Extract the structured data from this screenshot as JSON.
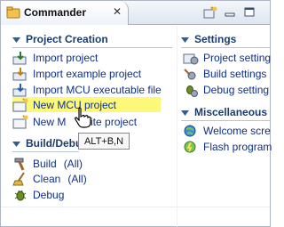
{
  "window": {
    "title": "Commander"
  },
  "project_creation": {
    "title": "Project Creation",
    "items": [
      {
        "label": "Import project",
        "icon": "import-project-icon"
      },
      {
        "label": "Import example project",
        "icon": "import-example-icon"
      },
      {
        "label": "Import MCU executable file",
        "icon": "import-executable-icon"
      },
      {
        "label": "New MCU project",
        "icon": "new-mcu-project-icon"
      },
      {
        "label": "New M",
        "label_tail": "Lite project",
        "icon": "new-lite-project-icon"
      }
    ]
  },
  "build_debug": {
    "title": "Build/Debu",
    "items": [
      {
        "label": "Build",
        "suffix": "(All)",
        "icon": "hammer-icon"
      },
      {
        "label": "Clean",
        "suffix": "(All)",
        "icon": "broom-icon"
      },
      {
        "label": "Debug",
        "icon": "bug-icon"
      }
    ]
  },
  "settings": {
    "title": "Settings",
    "items": [
      {
        "label": "Project setting",
        "icon": "project-settings-icon"
      },
      {
        "label": "Build settings",
        "icon": "build-settings-icon"
      },
      {
        "label": "Debug setting",
        "icon": "debug-settings-icon"
      }
    ]
  },
  "miscellaneous": {
    "title": "Miscellaneous",
    "items": [
      {
        "label": "Welcome scre",
        "icon": "welcome-icon"
      },
      {
        "label": "Flash program",
        "icon": "flash-icon"
      }
    ]
  },
  "tooltip": {
    "text": "ALT+B,N"
  },
  "colors": {
    "link": "#0d2f8b",
    "section_title": "#1b3c6b",
    "highlight": "#fdf87a"
  }
}
